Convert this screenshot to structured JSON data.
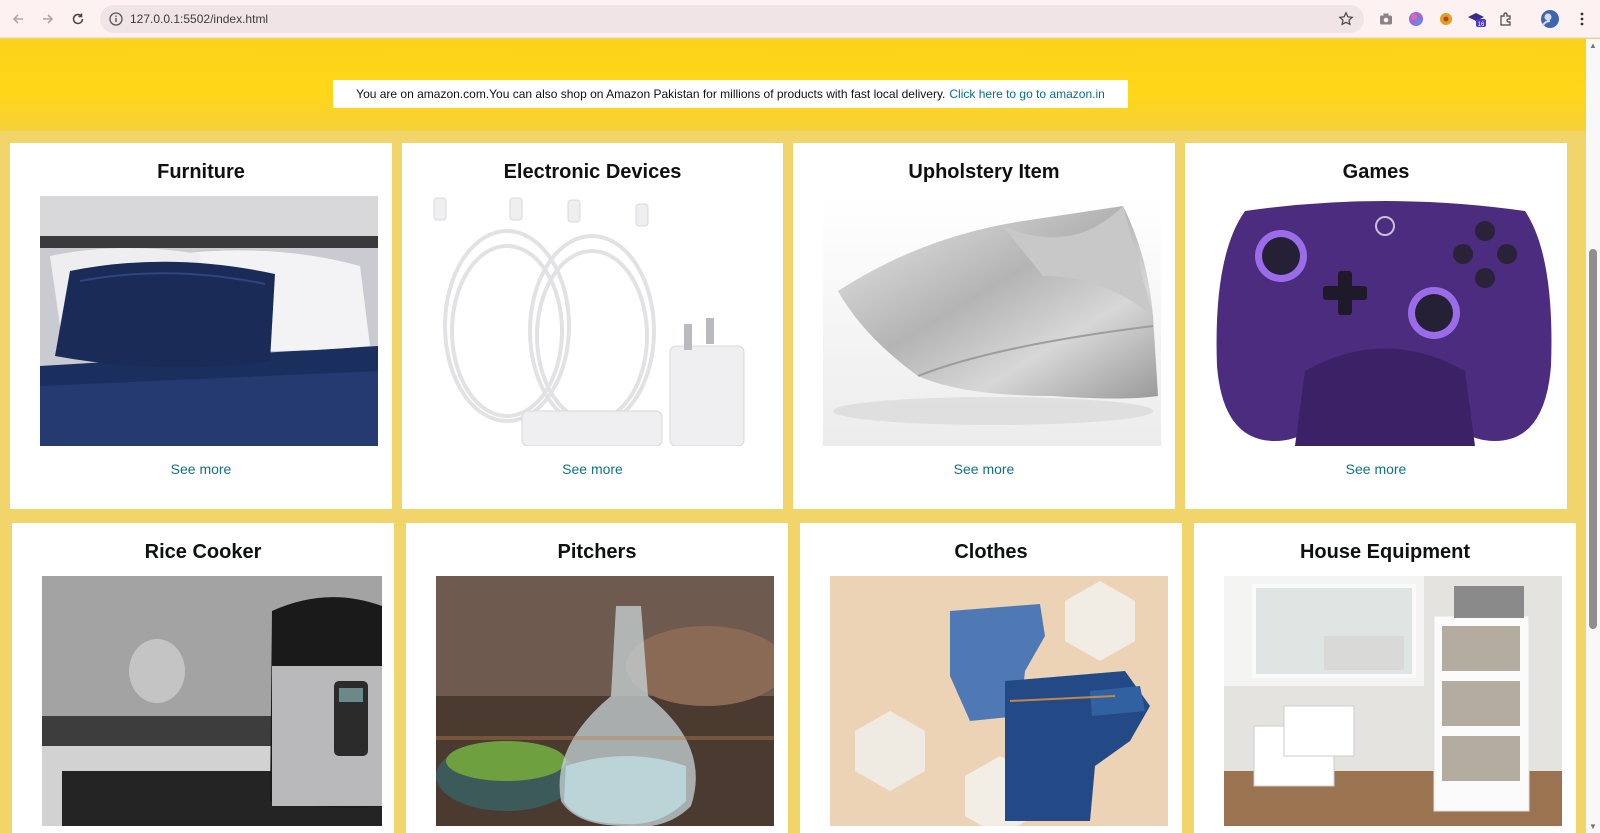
{
  "browser": {
    "url": "127.0.0.1:5502/index.html",
    "extension_badge": "16"
  },
  "notice": {
    "text": "You are on amazon.com.You can also shop on Amazon Pakistan for millions of products with fast local delivery.",
    "link": "Click here to go to amazon.in"
  },
  "cards": [
    {
      "title": "Furniture",
      "link": "See more",
      "image": "navy-pillow-bed"
    },
    {
      "title": "Electronic Devices",
      "link": "See more",
      "image": "usb-c-cables-charger"
    },
    {
      "title": "Upholstery Item",
      "link": "See more",
      "image": "silver-satin-pillow"
    },
    {
      "title": "Games",
      "link": "See more",
      "image": "purple-game-controller"
    },
    {
      "title": "Rice Cooker",
      "image": "pressure-cooker"
    },
    {
      "title": "Pitchers",
      "image": "glass-water-pitcher"
    },
    {
      "title": "Clothes",
      "image": "folded-jeans"
    },
    {
      "title": "House Equipment",
      "image": "white-storage-cabinet"
    }
  ],
  "colors": {
    "page_bg": "#f2d56a",
    "hero_yellow": "#fed21a",
    "link": "#127085",
    "notice_link": "#0b6b8b"
  }
}
